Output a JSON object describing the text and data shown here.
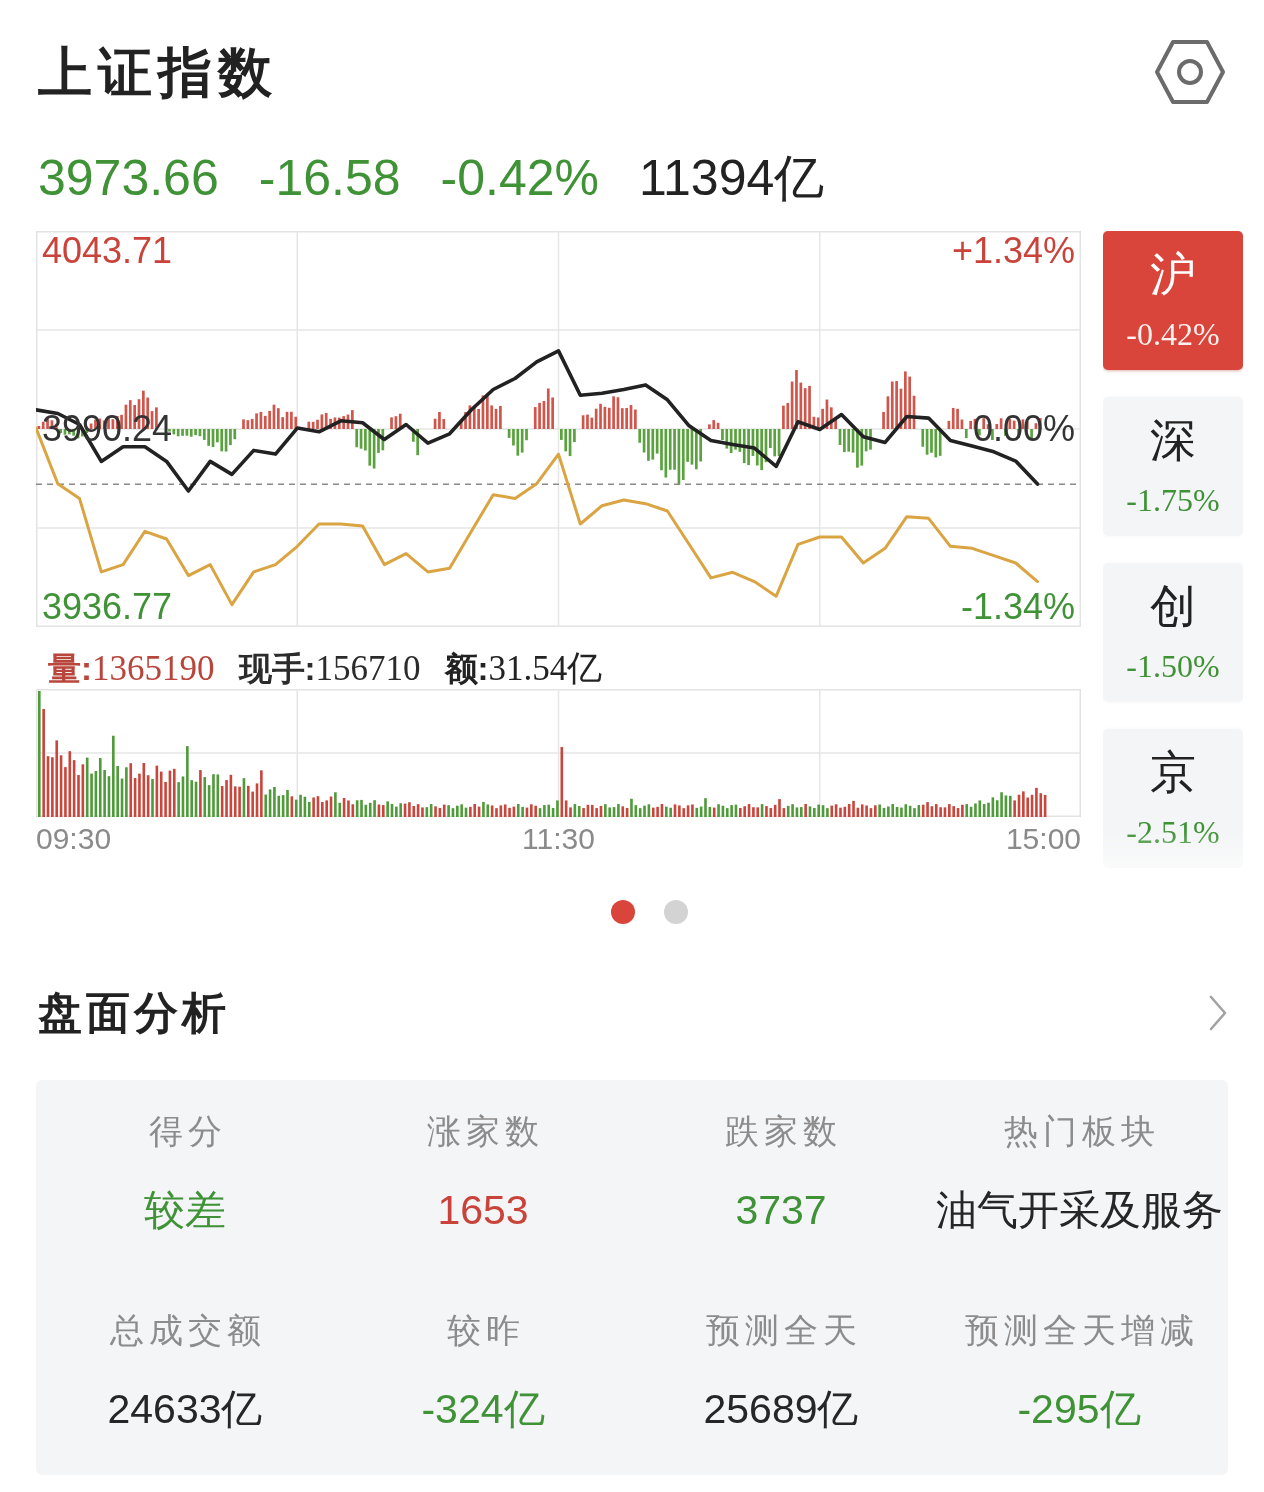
{
  "header": {
    "title": "上证指数"
  },
  "quote": {
    "price": "3973.66",
    "change": "-16.58",
    "change_percent": "-0.42%",
    "turnover": "11394亿",
    "rising": false
  },
  "intraday": {
    "chart_data": {
      "type": "line",
      "categories": [
        null,
        null,
        null,
        null,
        null,
        null,
        null,
        null,
        null,
        null,
        null,
        null,
        null,
        null,
        null,
        null,
        null,
        null,
        null,
        null,
        null,
        null,
        null,
        null,
        null,
        null,
        null,
        null,
        null,
        null,
        null,
        null,
        null,
        null,
        null,
        null,
        null,
        null,
        null,
        null,
        null,
        null,
        null,
        null,
        null,
        null,
        null,
        null,
        null
      ],
      "series": [
        {
          "color": "#222222",
          "values": [
            3996.0,
            3994.9,
            3991.6,
            3980.5,
            3984.9,
            3984.9,
            3980.5,
            3971.6,
            3980.5,
            3976.6,
            3983.8,
            3982.7,
            3990.5,
            3989.4,
            3992.7,
            3992.1,
            3987.1,
            3991.6,
            3986.0,
            3988.8,
            3996.0,
            4002.1,
            4005.4,
            4010.4,
            4013.7,
            4000.4,
            4001.0,
            4002.1,
            4003.5,
            3999.0,
            3991.2,
            3986.8,
            3985.6,
            3984.5,
            3979.0,
            3992.4,
            3990.1,
            3994.6,
            3987.9,
            3986.2,
            3994.0,
            3993.5,
            3986.8,
            3985.1,
            3983.4,
            3980.6,
            3973.7,
            null,
            null
          ]
        },
        {
          "color": "#dba443",
          "values": [
            3990.5,
            3973.8,
            3969.4,
            3947.3,
            3949.5,
            3959.5,
            3957.2,
            3946.2,
            3949.5,
            3937.5,
            3947.3,
            3949.5,
            3955.0,
            3961.7,
            3961.7,
            3961.1,
            3949.5,
            3952.8,
            3947.3,
            3948.4,
            3959.5,
            3970.5,
            3969.4,
            3973.8,
            3982.7,
            3961.7,
            3967.2,
            3968.9,
            3967.8,
            3965.6,
            3955.6,
            3945.5,
            3947.2,
            3944.4,
            3940.0,
            3955.6,
            3957.8,
            3957.8,
            3950.0,
            3954.4,
            3963.9,
            3963.4,
            3955.0,
            3954.4,
            3952.2,
            3950.0,
            3944.4,
            null,
            null
          ]
        }
      ],
      "ylim": [
        3930.76,
        4049.72
      ],
      "yticks": [
        {
          "value": 4043.71,
          "label": "4043.71"
        },
        {
          "value": 3990.24,
          "label": "3990.24"
        },
        {
          "value": 3936.77,
          "label": "3936.77"
        }
      ],
      "grid": true,
      "ref_lines": [
        {
          "axis": "y",
          "value": 3973.66
        }
      ]
    },
    "percent_labels": [
      {
        "text": "+1.34%",
        "color": "#c9433a"
      },
      {
        "text": "0.00%",
        "color": "#333333"
      },
      {
        "text": "-1.34%",
        "color": "#3f9236"
      }
    ],
    "volume_stats": [
      {
        "label": "量:",
        "value": "1365190",
        "color": "#b8463c"
      },
      {
        "label": "现手:",
        "value": "156710",
        "color": "#2b2b2b"
      },
      {
        "label": "额:",
        "value": "31.54亿",
        "color": "#222222"
      }
    ],
    "time_labels": [
      "09:30",
      "11:30",
      "15:00"
    ]
  },
  "markets": [
    {
      "label": "沪",
      "change": "-0.42%",
      "selected": true,
      "rising": false
    },
    {
      "label": "深",
      "change": "-1.75%",
      "selected": false,
      "rising": false
    },
    {
      "label": "创",
      "change": "-1.50%",
      "selected": false,
      "rising": false
    },
    {
      "label": "京",
      "change": "-2.51%",
      "selected": false,
      "rising": false
    }
  ],
  "pager": [
    {
      "selected": true
    },
    {
      "selected": false
    }
  ],
  "analysis": {
    "title": "盘面分析",
    "metrics": [
      {
        "label": "得分",
        "value": "较差",
        "color": "#3f9236"
      },
      {
        "label": "涨家数",
        "value": "1653",
        "color": "#c9433a"
      },
      {
        "label": "跌家数",
        "value": "3737",
        "color": "#3f9236"
      },
      {
        "label": "热门板块",
        "value": "油气开采及服务",
        "color": "#262626"
      },
      {
        "label": "总成交额",
        "value": "24633亿",
        "color": "#262626"
      },
      {
        "label": "较昨",
        "value": "-324亿",
        "color": "#3f9236"
      },
      {
        "label": "预测全天",
        "value": "25689亿",
        "color": "#262626"
      },
      {
        "label": "预测全天增减",
        "value": "-295亿",
        "color": "#3f9236"
      }
    ]
  }
}
